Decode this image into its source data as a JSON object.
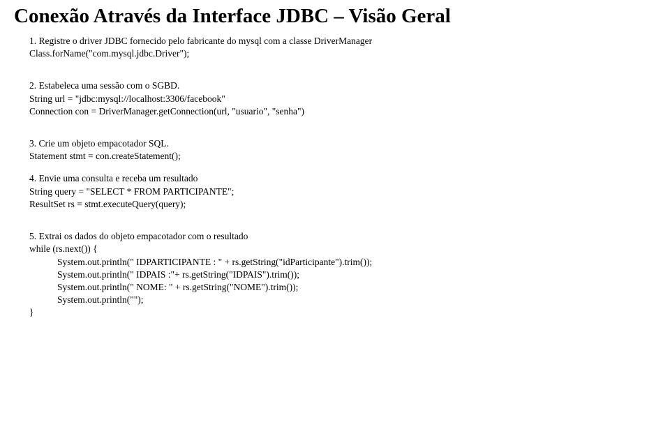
{
  "title": "Conexão Através da Interface JDBC – Visão Geral",
  "items": [
    {
      "intro": "1.  Registre o driver JDBC fornecido pelo fabricante do mysql com a classe DriverManager",
      "lines": [
        "Class.forName(\"com.mysql.jdbc.Driver\");"
      ]
    },
    {
      "intro": "2.  Estabeleca uma sessão com o SGBD.",
      "lines": [
        "String url = \"jdbc:mysql://localhost:3306/facebook\"",
        "Connection con = DriverManager.getConnection(url, \"usuario\", \"senha\")"
      ]
    },
    {
      "intro": "3.  Crie um objeto empacotador SQL.",
      "lines": [
        "Statement stmt = con.createStatement();"
      ]
    },
    {
      "intro": "4.  Envie uma consulta e receba um resultado",
      "lines": [
        "String query = \"SELECT * FROM PARTICIPANTE\";",
        "ResultSet rs = stmt.executeQuery(query);"
      ]
    },
    {
      "intro": "5.  Extrai os dados do objeto empacotador com o resultado",
      "lines": [
        "while (rs.next()) {",
        "    System.out.println(\" IDPARTICIPANTE  : \" + rs.getString(\"idParticipante\").trim());",
        "    System.out.println(\" IDPAIS   :\"+ rs.getString(\"IDPAIS\").trim());",
        "    System.out.println(\" NOME: \" + rs.getString(\"NOME\").trim());",
        "    System.out.println(\"\");",
        "}"
      ]
    }
  ]
}
